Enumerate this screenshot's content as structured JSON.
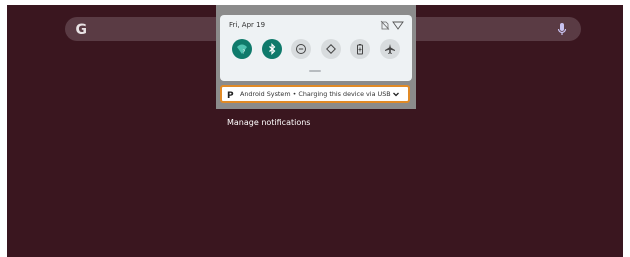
{
  "colors": {
    "wallpaper": "#3a161f",
    "search_bar": "#5a3b44",
    "shade_bg": "#8b8b8b",
    "tile_on": "#0f7a6b",
    "tile_off": "#d8dcde",
    "highlight": "#e18a26"
  },
  "search_bar": {
    "logo_icon": "google-logo-icon",
    "mic_icon": "mic-icon"
  },
  "shade": {
    "date": "Fri, Apr 19",
    "status_icons": [
      "no-sim-icon",
      "wifi-outline-icon"
    ],
    "tiles": [
      {
        "name": "wifi-tile",
        "icon": "wifi-icon",
        "active": true
      },
      {
        "name": "bluetooth-tile",
        "icon": "bluetooth-icon",
        "active": true
      },
      {
        "name": "dnd-tile",
        "icon": "do-not-disturb-icon",
        "active": false
      },
      {
        "name": "auto-rotate-tile",
        "icon": "auto-rotate-icon",
        "active": false
      },
      {
        "name": "battery-saver-tile",
        "icon": "battery-icon",
        "active": false
      },
      {
        "name": "airplane-mode-tile",
        "icon": "airplane-icon",
        "active": false
      }
    ]
  },
  "notification": {
    "icon": "android-system-p-icon",
    "text": "Android System • Charging this device via USB",
    "expand_icon": "chevron-down-icon"
  },
  "manage_notifications": "Manage notifications"
}
